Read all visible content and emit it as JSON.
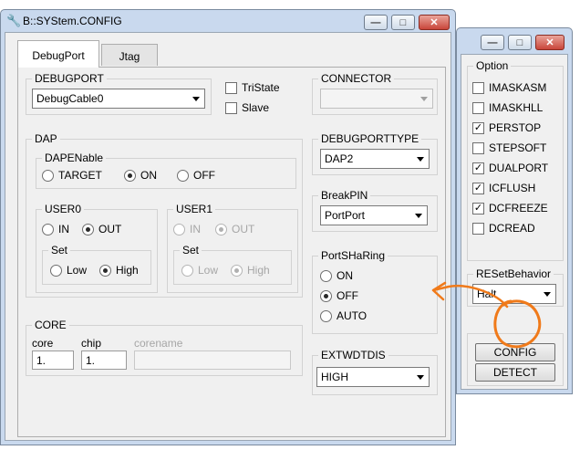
{
  "main_window": {
    "title": "B::SYStem.CONFIG",
    "buttons": {
      "minimize": "—",
      "maximize": "□",
      "close": "✕"
    },
    "tabs": [
      {
        "label": "DebugPort"
      },
      {
        "label": "Jtag"
      }
    ],
    "debugport": {
      "label": "DEBUGPORT",
      "value": "DebugCable0"
    },
    "tristate": {
      "label": "TriState",
      "checked": false
    },
    "slave": {
      "label": "Slave",
      "checked": false
    },
    "connector": {
      "label": "CONNECTOR",
      "value": ""
    },
    "dap": {
      "label": "DAP",
      "dapenable": {
        "label": "DAPENable",
        "options": [
          "TARGET",
          "ON",
          "OFF"
        ],
        "selected": "ON"
      },
      "user0": {
        "label": "USER0",
        "options": [
          "IN",
          "OUT"
        ],
        "selected": "OUT",
        "set": {
          "label": "Set",
          "options": [
            "Low",
            "High"
          ],
          "selected": "High"
        }
      },
      "user1": {
        "label": "USER1",
        "options": [
          "IN",
          "OUT"
        ],
        "selected": "OUT",
        "set": {
          "label": "Set",
          "options": [
            "Low",
            "High"
          ],
          "selected": "High"
        }
      }
    },
    "debugporttype": {
      "label": "DEBUGPORTTYPE",
      "value": "DAP2"
    },
    "breakpin": {
      "label": "BreakPIN",
      "value": "PortPort"
    },
    "portsharing": {
      "label": "PortSHaRing",
      "options": [
        "ON",
        "OFF",
        "AUTO"
      ],
      "selected": "OFF"
    },
    "core": {
      "label": "CORE",
      "core_label": "core",
      "core_value": "1.",
      "chip_label": "chip",
      "chip_value": "1.",
      "corename_label": "corename",
      "corename_value": ""
    },
    "extwdtdis": {
      "label": "EXTWDTDIS",
      "value": "HIGH"
    }
  },
  "option_window": {
    "buttons": {
      "minimize": "—",
      "maximize": "□",
      "close": "✕"
    },
    "option_label": "Option",
    "options": [
      {
        "label": "IMASKASM",
        "checked": false
      },
      {
        "label": "IMASKHLL",
        "checked": false
      },
      {
        "label": "PERSTOP",
        "checked": true
      },
      {
        "label": "STEPSOFT",
        "checked": false
      },
      {
        "label": "DUALPORT",
        "checked": true
      },
      {
        "label": "ICFLUSH",
        "checked": true
      },
      {
        "label": "DCFREEZE",
        "checked": true
      },
      {
        "label": "DCREAD",
        "checked": false
      }
    ],
    "reset_behavior": {
      "label": "RESetBehavior",
      "value": "Halt"
    },
    "config_button": "CONFIG",
    "detect_button": "DETECT"
  },
  "annotation": {
    "color": "#f07a1a",
    "shape": "hand-drawn circle and arrow"
  }
}
